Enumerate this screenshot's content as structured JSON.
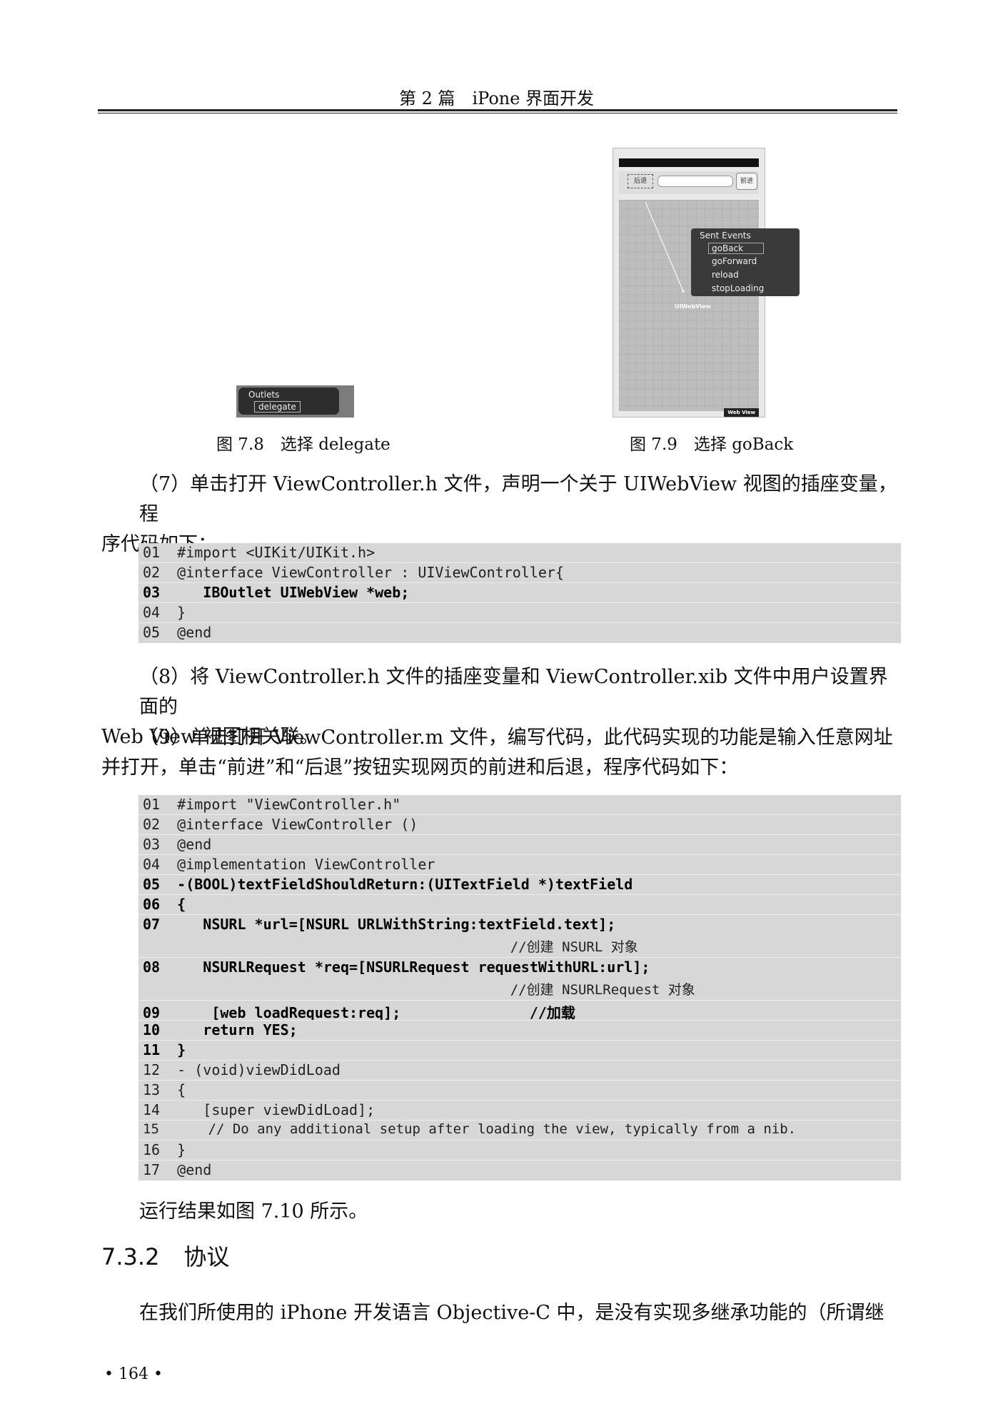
{
  "header": {
    "title": "第 2 篇　iPone 界面开发"
  },
  "figure_7_8": {
    "outlets_title": "Outlets",
    "outlet_item": "delegate",
    "caption": "图 7.8　选择 delegate"
  },
  "figure_7_9": {
    "back_button": "后退",
    "forward_button": "前进",
    "sent_events_title": "Sent Events",
    "events": [
      "goBack",
      "goForward",
      "reload",
      "stopLoading"
    ],
    "view_label": "UIWebView",
    "tag": "Web View",
    "caption": "图 7.9　选择 goBack"
  },
  "step7": {
    "line1": "（7）单击打开 ViewController.h 文件，声明一个关于 UIWebView 视图的插座变量，程",
    "line2": "序代码如下："
  },
  "code1": [
    "01  #import <UIKit/UIKit.h>",
    "02  @interface ViewController : UIViewController{",
    "03     IBOutlet UIWebView *web;",
    "04  }",
    "05  @end"
  ],
  "step8": {
    "line1": "（8）将 ViewController.h 文件的插座变量和 ViewController.xib 文件中用户设置界面的",
    "line2": "Web View 视图相关联。"
  },
  "step9": {
    "line1": "（9）单击打开 ViewController.m 文件，编写代码，此代码实现的功能是输入任意网址",
    "line2": "并打开，单击“前进”和“后退”按钮实现网页的前进和后退，程序代码如下："
  },
  "code2": [
    "01  #import \"ViewController.h\"",
    "02  @interface ViewController ()",
    "03  @end",
    "04  @implementation ViewController",
    "05  -(BOOL)textFieldShouldReturn:(UITextField *)textField",
    "06  {",
    "07     NSURL *url=[NSURL URLWithString:textField.text];",
    "                                             //创建 NSURL 对象",
    "08     NSURLRequest *req=[NSURLRequest requestWithURL:url];",
    "                                             //创建 NSURLRequest 对象",
    "09      [web loadRequest:req];               //加载",
    "10     return YES;",
    "11  }",
    "12  - (void)viewDidLoad",
    "13  {",
    "14     [super viewDidLoad];",
    "15      // Do any additional setup after loading the view, typically from a nib.",
    "16  }",
    "17  @end"
  ],
  "result_text": "运行结果如图 7.10 所示。",
  "section": {
    "number": "7.3.2",
    "title": "协议"
  },
  "last_para": "在我们所使用的 iPhone 开发语言 Objective-C 中，是没有实现多继承功能的（所谓继",
  "page_number": "• 164 •"
}
